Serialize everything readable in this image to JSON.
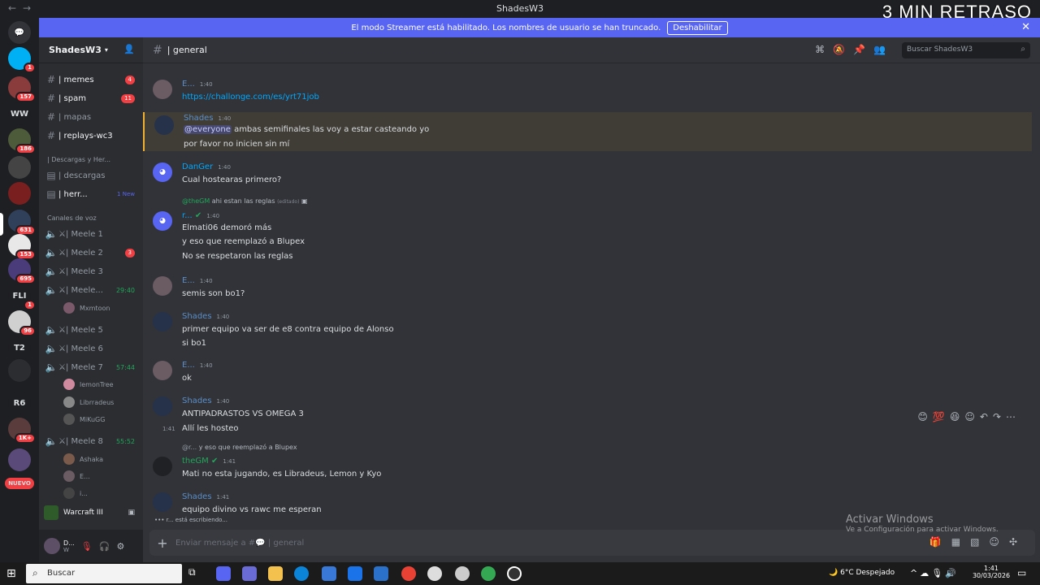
{
  "overlay_text": "3 MIN RETRASO",
  "window": {
    "title": "ShadesW3",
    "nav_back": "←",
    "nav_forward": "→"
  },
  "banner": {
    "text": "El modo Streamer está habilitado. Los nombres de usuario se han truncado.",
    "button": "Deshabilitar",
    "close": "✕"
  },
  "rail": {
    "servers": [
      {
        "label": "",
        "badge": ""
      },
      {
        "label": "",
        "badge": "1"
      },
      {
        "label": "",
        "badge": "157"
      },
      {
        "label": "WW",
        "badge": ""
      },
      {
        "label": "",
        "badge": "186"
      },
      {
        "label": "",
        "badge": ""
      },
      {
        "label": "",
        "badge": ""
      },
      {
        "label": "",
        "badge": "631"
      },
      {
        "label": "",
        "badge": "153"
      },
      {
        "label": "",
        "badge": "695"
      },
      {
        "label": "FLI",
        "badge": "1"
      },
      {
        "label": "",
        "badge": "96"
      },
      {
        "label": "T2",
        "badge": ""
      },
      {
        "label": "",
        "badge": ""
      },
      {
        "label": "R6",
        "badge": ""
      },
      {
        "label": "",
        "badge": "1K+"
      },
      {
        "label": "",
        "badge": ""
      },
      {
        "label": "NUEVO",
        "badge": ""
      }
    ]
  },
  "sidebar": {
    "server_name": "ShadesW3",
    "channels": [
      {
        "name": "| memes",
        "count": "4"
      },
      {
        "name": "| spam",
        "count": "11"
      },
      {
        "name": "| mapas",
        "count": ""
      },
      {
        "name": "| replays-wc3",
        "count": ""
      }
    ],
    "category_downloads": "| Descargas y Her...",
    "downloads": [
      {
        "name": "| descargas",
        "tag": ""
      },
      {
        "name": "| herr...",
        "tag": "1 New"
      }
    ],
    "voice_category": "Canales de voz",
    "voice_channels": [
      {
        "name": "⚔| Meele 1",
        "extra": ""
      },
      {
        "name": "⚔| Meele 2",
        "extra": "3"
      },
      {
        "name": "⚔| Meele 3",
        "extra": ""
      },
      {
        "name": "⚔| Meele...",
        "extra": "29:40"
      },
      {
        "name": "⚔| Meele 5",
        "extra": ""
      },
      {
        "name": "⚔| Meele 6",
        "extra": ""
      },
      {
        "name": "⚔| Meele 7",
        "extra": "57:44"
      },
      {
        "name": "⚔| Meele 8",
        "extra": "55:52"
      }
    ],
    "members_meele4": [
      "Mxmtoon"
    ],
    "members_meele7": [
      "lemonTree",
      "Librradeus",
      "MiKuGG"
    ],
    "members_meele8": [
      "Ashaka",
      "E...",
      "i..."
    ],
    "game": "Warcraft III",
    "user": {
      "name": "D...",
      "status": "W"
    }
  },
  "header": {
    "channel": "| general",
    "search_placeholder": "Buscar ShadesW3"
  },
  "messages": [
    {
      "author": "E...",
      "time": "1:40",
      "lines": [
        "https://challonge.com/es/yrt71job"
      ]
    },
    {
      "author": "Shades",
      "time": "1:40",
      "mention": "@everyone",
      "lines": [
        "ambas semifinales las voy a estar casteando yo",
        "por favor no inicien sin mí"
      ]
    },
    {
      "author": "DanGer",
      "time": "1:40",
      "lines": [
        "Cual hostearas primero?"
      ]
    },
    {
      "reply_author": "@theGM",
      "reply_text": "ahi estan las reglas",
      "reply_edited": "(editado)",
      "author": "r...",
      "time": "1:40",
      "lines": [
        "Elmati06 demoró más",
        "y eso que reemplazó a Blupex",
        "No se respetaron las reglas"
      ]
    },
    {
      "author": "E...",
      "time": "1:40",
      "lines": [
        "semis son bo1?"
      ]
    },
    {
      "author": "Shades",
      "time": "1:40",
      "lines": [
        "primer equipo va ser de e8 contra equipo de Alonso",
        "si bo1"
      ]
    },
    {
      "author": "E...",
      "time": "1:40",
      "lines": [
        "ok"
      ]
    },
    {
      "author": "Shades",
      "time": "1:40",
      "hover_time": "1:41",
      "lines": [
        "ANTIPADRASTOS VS OMEGA 3",
        "Allí les hosteo"
      ]
    },
    {
      "reply_author": "@r...",
      "reply_text": "y eso que reemplazó a Blupex",
      "author": "theGM",
      "time": "1:41",
      "lines": [
        "Mati no esta jugando, es Libradeus,  Lemon y Kyo"
      ]
    },
    {
      "author": "Shades",
      "time": "1:41",
      "lines": [
        "equipo divino vs rawc me esperan"
      ]
    }
  ],
  "typing": "r... está escribiendo...",
  "composer": {
    "placeholder": "Enviar mensaje a #💬 | general"
  },
  "watermark": {
    "line1": "Activar Windows",
    "line2": "Ve a Configuración para activar Windows."
  },
  "taskbar": {
    "search": "Buscar",
    "weather": "6°C  Despejado",
    "time": "1:41",
    "date": "30/03/2026"
  },
  "colors": {
    "accent": "#5865f2",
    "shades": "#5b8ec7",
    "green_name": "#23a55a",
    "link": "#00a8fc"
  }
}
